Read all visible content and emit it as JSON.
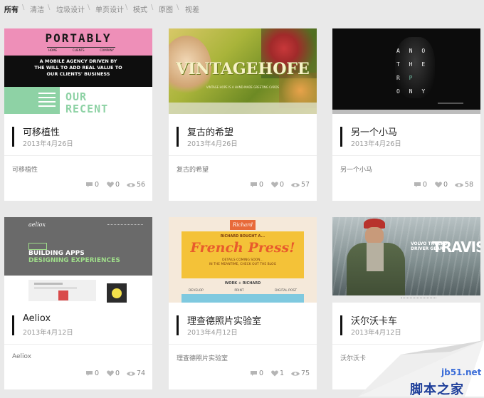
{
  "filters": [
    {
      "label": "所有",
      "active": true
    },
    {
      "label": "清洁"
    },
    {
      "label": "垃圾设计"
    },
    {
      "label": "单页设计"
    },
    {
      "label": "模式"
    },
    {
      "label": "原图"
    },
    {
      "label": "视差"
    }
  ],
  "filter_separator": "\\",
  "cards": [
    {
      "title": "可移植性",
      "date": "2013年4月26日",
      "desc": "可移植性",
      "comments": "0",
      "likes": "0",
      "views": "56",
      "thumb": {
        "logo": "PORTABLY",
        "nav": [
          "HOME",
          "CLIENTS",
          "COMPANY"
        ],
        "tagline": [
          "A MOBILE AGENCY DRIVEN BY",
          "THE WILL TO ADD REAL VALUE TO",
          "OUR CLIENTS' BUSINESS"
        ],
        "recent": [
          "OUR",
          "RECENT"
        ]
      }
    },
    {
      "title": "复古的希望",
      "date": "2013年4月26日",
      "desc": "复古的希望",
      "comments": "0",
      "likes": "0",
      "views": "57",
      "thumb": {
        "logo": "VINTAGEHOFE",
        "sub": "VINTAGE HOPE IS A HAND-MADE GREETING CARDS"
      }
    },
    {
      "title": "另一个小马",
      "date": "2013年4月26日",
      "desc": "另一个小马",
      "comments": "0",
      "likes": "0",
      "views": "58",
      "thumb": {
        "letters": [
          "A",
          "N",
          "O",
          "T",
          "H",
          "E",
          "R",
          "P",
          "O",
          "N",
          "Y"
        ]
      }
    },
    {
      "title": "Aeliox",
      "date": "2013年4月12日",
      "desc": "Aeliox",
      "comments": "0",
      "likes": "0",
      "views": "74",
      "thumb": {
        "logo": "aeliox",
        "headline1": "BUILDING APPS",
        "headline2": "DESIGNING EXPERIENCES"
      }
    },
    {
      "title": "理查德照片实验室",
      "date": "2013年4月12日",
      "desc": "理查德照片实验室",
      "comments": "0",
      "likes": "1",
      "views": "75",
      "thumb": {
        "badge": "Richard",
        "top": "RICHARD BOUGHT A...",
        "headline": "French Press!",
        "sub": [
          "DETAILS COMING SOON...",
          "IN THE MEANTIME, CHECK OUT THE BLOG"
        ],
        "work": "WORK + RICHARD",
        "cols": [
          "DEVELOP",
          "PRINT",
          "DIGITAL POST"
        ]
      }
    },
    {
      "title": "沃尔沃卡车",
      "date": "2013年4月12日",
      "desc": "沃尔沃卡",
      "thumb": {
        "big": "TRAVIS",
        "small": [
          "VOLVO TRUCKS",
          "DRIVER GEAR"
        ]
      }
    }
  ],
  "icons": {
    "comment": "comment-icon",
    "like": "heart-icon",
    "view": "eye-icon"
  },
  "watermark": {
    "text1": "jb51.net",
    "text2": "脚本之家"
  }
}
